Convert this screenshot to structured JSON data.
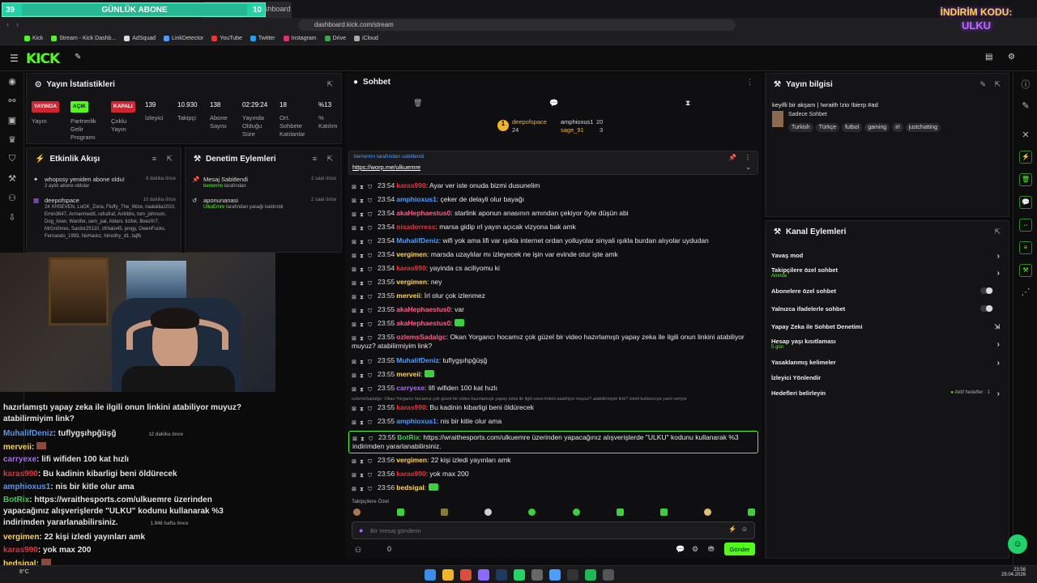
{
  "browser": {
    "tab_active": "Stream - Kick Dashboard",
    "url": "dashboard.kick.com/stream",
    "bookmarks": [
      "Kick",
      "Stream - Kick Dashb...",
      "AdSquad",
      "LinkDetector",
      "YouTube",
      "Twitter",
      "Instagram",
      "Drive",
      "iCloud"
    ]
  },
  "overlay": {
    "abone_left": "39",
    "abone_title": "GÜNLÜK ABONE",
    "abone_right": "10",
    "indirim_title": "İNDİRİM KODU:",
    "indirim_code": "ULKU"
  },
  "stats": {
    "title": "Yayın İstatistikleri",
    "items": [
      {
        "badge": "YAYINDA",
        "label": "Yayın"
      },
      {
        "badge": "AÇIK",
        "label": "Partnerlik Gelir Programı"
      },
      {
        "badge": "KAPALI",
        "label": "Çoklu Yayın"
      },
      {
        "value": "139",
        "label": "İzleyici"
      },
      {
        "value": "10.930",
        "label": "Takipçi"
      },
      {
        "value": "138",
        "label": "Abone Sayısı"
      },
      {
        "value": "02:29:24",
        "label": "Yayında Olduğu Süre"
      },
      {
        "value": "18",
        "label": "Ort. Sohbete Katılanlar"
      },
      {
        "value": "%13",
        "label": "% Katılım"
      }
    ]
  },
  "activity": {
    "title": "Etkinlik Akışı",
    "items": [
      {
        "user": "whopssy yeniden abone oldu!",
        "sub": "2 aylık abone oldular",
        "time": "8 dakika önce"
      },
      {
        "user": "deepofspace",
        "sub": "24 XHSEVEN, LoGK_Zona, Fluffy_The_Wize, naataliia1010, Emin3647, Armanmed8, rafrafraf, Antiiblis, tom_johnson, Dog_lover, Wanifer, sem_pal, Ablarv, Iizilsk, Beez0r7, MrGn0mes, Sardor25110, zKhalo45, jengy, OwenFucks, Fernando_1993, NoHackz, himothy_d1, tajfb",
        "time": "10 dakika önce"
      }
    ]
  },
  "moderation": {
    "title": "Denetim Eylemleri",
    "items": [
      {
        "action": "Mesaj Sabitlendi",
        "by": "berrennn",
        "suffix": "tarafından",
        "time": "2 saat önce"
      },
      {
        "action": "aponunanasi",
        "by": "UlkuEmre",
        "suffix": "tarafından yasağı kaldırıldı",
        "time": "2 saat önce"
      }
    ]
  },
  "chat": {
    "title": "Sohbet",
    "top_gifters": [
      {
        "name": "deepofspace",
        "count": "24"
      },
      {
        "name": "amphioxus1",
        "count": "20"
      },
      {
        "name": "sage_91",
        "count": "3"
      }
    ],
    "pinned": {
      "by": "berrennn tarafından sabitlendi",
      "link": "https://worp.me/ulkuemre"
    },
    "messages": [
      {
        "time": "23:54",
        "user": "karas990",
        "color": "red",
        "text": "Ayar ver iste onuda bizmi dusunelim"
      },
      {
        "time": "23:54",
        "user": "amphioxus1",
        "color": "blue",
        "text": "çeker de delayli olur bayağı"
      },
      {
        "time": "23:54",
        "user": "akaHephaestus0",
        "color": "pink",
        "text": "starlink aponun anasının amından çekiyor öyle düşün abi"
      },
      {
        "time": "23:54",
        "user": "nisadorress",
        "color": "red",
        "text": "marsa gidip ırl yayın açıcak vizyona bak amk"
      },
      {
        "time": "23:54",
        "user": "MuhalifDeniz",
        "color": "blue",
        "text": "wifi yok ama lifi var ışıkla internet ordan yolluyolar sinyali ışıkla burdan alıyolar uydudan"
      },
      {
        "time": "23:54",
        "user": "vergimen",
        "color": "yel",
        "text": "marsda uzaylılar mı izleyecek ne işin var evinde otur işte amk"
      },
      {
        "time": "23:54",
        "user": "karas990",
        "color": "red",
        "text": "yayinda cs aciliyomu ki"
      },
      {
        "time": "23:55",
        "user": "vergimen",
        "color": "yel",
        "text": "ney"
      },
      {
        "time": "23:55",
        "user": "merveii",
        "color": "yel",
        "text": "İrl olur çok izlenmez"
      },
      {
        "time": "23:55",
        "user": "akaHephaestus0",
        "color": "pink",
        "text": "var"
      },
      {
        "time": "23:55",
        "user": "akaHephaestus0",
        "color": "pink",
        "text": ""
      },
      {
        "time": "23:55",
        "user": "ozlemsSadalgc",
        "color": "pink",
        "text": "Okan Yorgancı hocamız çok güzel bir video hazırlamıştı yapay zeka ile ilgili onun linkini atabiliyor muyuz? atabilirmiyim link?"
      },
      {
        "time": "23:55",
        "user": "MuhalifDeniz",
        "color": "blue",
        "text": "tuflygşıhpğüşğ"
      },
      {
        "time": "23:55",
        "user": "merveii",
        "color": "yel",
        "text": ""
      },
      {
        "time": "23:55",
        "user": "carryexe",
        "color": "pur",
        "text": "lifi wifiden 100 kat hızlı"
      },
      {
        "time": "",
        "user": "",
        "color": "",
        "text": "ozlemsSadalgc: Okan Yorgancı hocamız çok güzel bir video hazırlamıştı yapay zeka ile ilgili onun linkini atabiliyor muyuz? atabilirmiyim link? isimli kullanıcıya yanıt veriyor"
      },
      {
        "time": "23:55",
        "user": "karas990",
        "color": "red",
        "text": "Bu kadinin kibarligi beni öldürecek"
      },
      {
        "time": "23:55",
        "user": "amphioxus1",
        "color": "blue",
        "text": "nis bir kitle olur ama"
      },
      {
        "time": "23:55",
        "user": "BotRix",
        "color": "grn",
        "text": "https://wraithesports.com/ulkuemre üzerinden yapacağınız alışverişlerde \"ULKU\" kodunu kullanarak %3 indirimden yararlanabilirsiniz."
      },
      {
        "time": "23:56",
        "user": "vergimen",
        "color": "yel",
        "text": "22 kişi izledi yayınları amk"
      },
      {
        "time": "23:56",
        "user": "karas990",
        "color": "red",
        "text": "yok max 200"
      },
      {
        "time": "23:56",
        "user": "bedsigal",
        "color": "yel",
        "text": ""
      }
    ],
    "followers_only_label": "Takipçilere Özel",
    "input_placeholder": "Bir mesaj gönderin",
    "points": "0",
    "send_label": "Gönder"
  },
  "stream_info": {
    "title": "Yayın bilgisi",
    "stream_title": "keyifli bir akşam | !wraith !zio !bierp #ad",
    "category": "Sadece Sohbet",
    "tags": [
      "Turkish",
      "Türkçe",
      "futbol",
      "gaming",
      "irl",
      "justchatting"
    ]
  },
  "channel_actions": {
    "title": "Kanal Eylemleri",
    "items": [
      {
        "label": "Yavaş mod",
        "sub": "",
        "control": "chevron"
      },
      {
        "label": "Takipçilere özel sohbet",
        "sub": "Anında",
        "control": "chevron"
      },
      {
        "label": "Abonelere özel sohbet",
        "sub": "",
        "control": "toggle"
      },
      {
        "label": "Yalnızca ifadelerle sohbet",
        "sub": "",
        "control": "toggle"
      },
      {
        "label": "Yapay Zeka ile Sohbet Denetimi",
        "sub": "",
        "control": "external"
      },
      {
        "label": "Hesap yaşı kısıtlaması",
        "sub": "5 gün",
        "control": "chevron"
      },
      {
        "label": "Yasaklanmış kelimeler",
        "sub": "",
        "control": "chevron"
      },
      {
        "label": "İzleyici Yönlendir",
        "sub": "",
        "control": "none"
      },
      {
        "label": "Hedefleri belirleyin",
        "sub": "",
        "control": "chevron",
        "status": "Aktif hedefler · 1"
      }
    ]
  },
  "overlay_chat": {
    "lines": [
      {
        "user": "",
        "text": "hazırlamıştı yapay zeka ile ilgili onun linkini atabiliyor muyuz?"
      },
      {
        "user": "",
        "text": "atabilirmiyim link?"
      },
      {
        "user": "MuhalifDeniz",
        "text": "tuflygşıhpğüşğ",
        "time": "12 dakika önce"
      },
      {
        "user": "merveii",
        "text": ""
      },
      {
        "user": "carryexe",
        "text": "lifi wifiden 100 kat hızlı"
      },
      {
        "user": "karas990",
        "text": "Bu kadinin kibarligi beni öldürecek"
      },
      {
        "user": "amphioxus1",
        "text": "nis bir kitle olur ama"
      },
      {
        "user": "BotRix",
        "text": "https://wraithesports.com/ulkuemre üzerinden"
      },
      {
        "user": "",
        "text": "yapacağınız alışverişlerde \"ULKU\" kodunu kullanarak %3"
      },
      {
        "user": "",
        "text": "indirimden yararlanabilirsiniz.",
        "time": "1.946 hafta önce"
      },
      {
        "user": "vergimen",
        "text": "22 kişi izledi yayınları amk"
      },
      {
        "user": "karas990",
        "text": "yok max 200"
      },
      {
        "user": "bedsigal",
        "text": ""
      }
    ]
  },
  "taskbar": {
    "weather": "8°C",
    "time": "23:56",
    "date": "29.04.2026"
  },
  "colors": {
    "kick_green": "#53fc18",
    "abone_teal": "#1fd3a7"
  }
}
